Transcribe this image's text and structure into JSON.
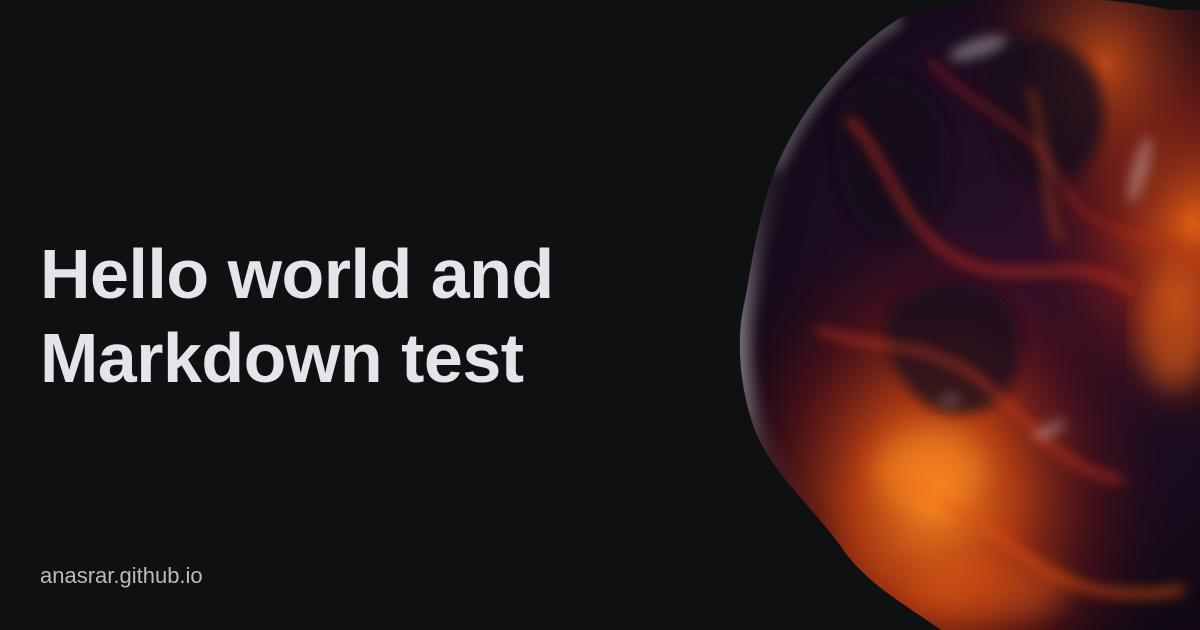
{
  "post": {
    "title_line1": "Hello world and",
    "title_line2": "Markdown test"
  },
  "footer": {
    "site": "anasrar.github.io"
  },
  "colors": {
    "background": "#0f1012",
    "title": "#e4e5ea",
    "site_text": "#b9bac0",
    "blob_dark": "#1a0d1f",
    "blob_red": "#8a1a12",
    "blob_orange": "#f06a14"
  },
  "art": {
    "icon": "liquid-blob-artwork"
  }
}
